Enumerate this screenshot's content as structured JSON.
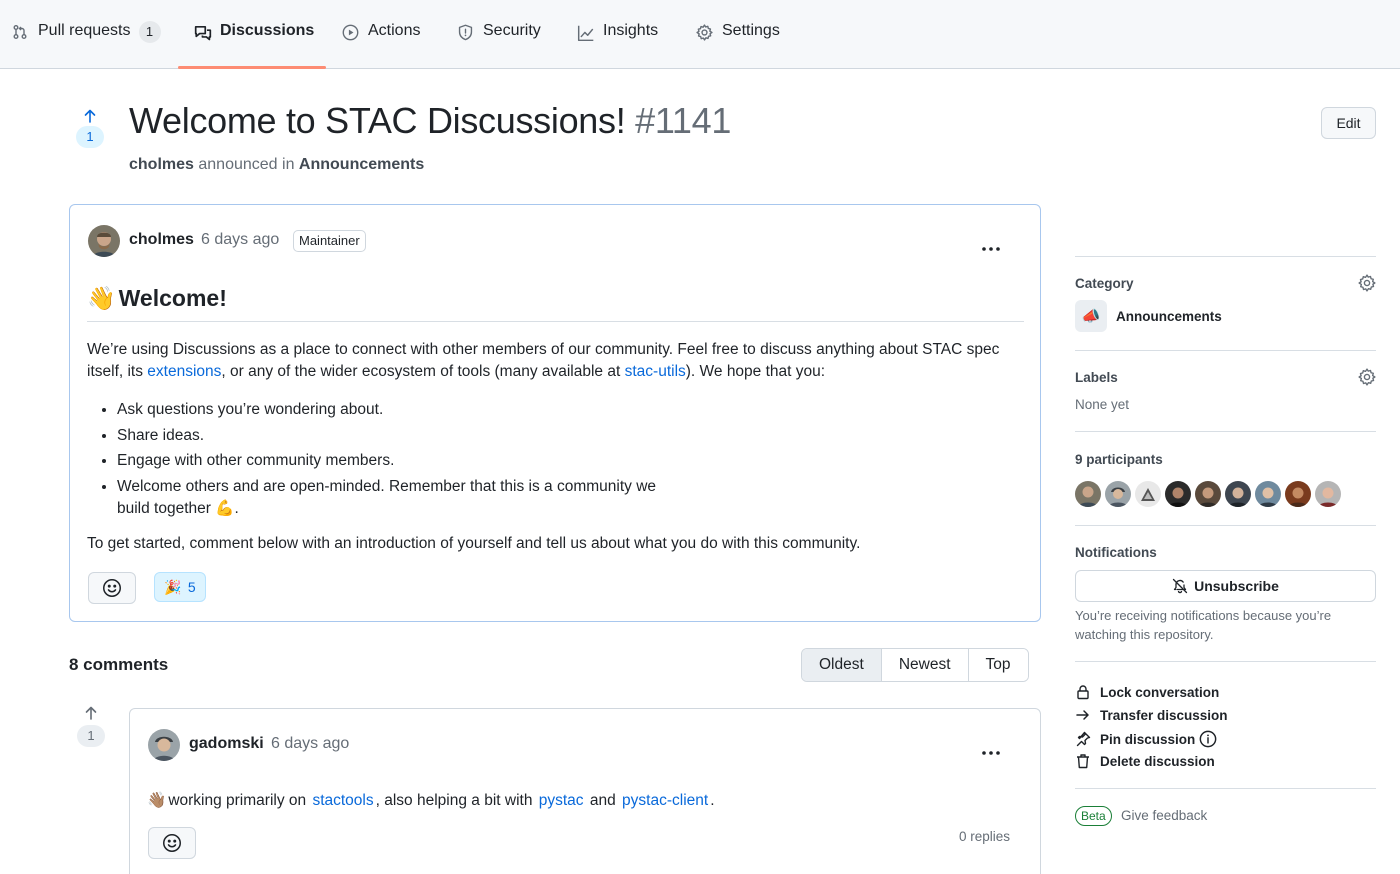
{
  "colors": {
    "accent": "#0969da",
    "nav_underline": "#fd8c73",
    "muted": "#656d76",
    "border": "#d0d7de",
    "post_border": "#a8c7ee",
    "beta_green": "#1a7f37"
  },
  "nav": {
    "pull_requests": {
      "label": "Pull requests",
      "count": "1",
      "icon": "git-pull-request-icon"
    },
    "discussions": {
      "label": "Discussions",
      "icon": "comment-discussion-icon",
      "active": true
    },
    "actions": {
      "label": "Actions",
      "icon": "play-icon"
    },
    "security": {
      "label": "Security",
      "icon": "shield-icon"
    },
    "insights": {
      "label": "Insights",
      "icon": "graph-icon"
    },
    "settings": {
      "label": "Settings",
      "icon": "gear-icon"
    }
  },
  "discussion": {
    "vote_count": "1",
    "title": "Welcome to STAC Discussions!",
    "number": "#1141",
    "author": "cholmes",
    "action_text": "announced in",
    "category": "Announcements",
    "edit_label": "Edit"
  },
  "post": {
    "author": "cholmes",
    "time": "6 days ago",
    "badge": "Maintainer",
    "heading_emoji": "👋",
    "heading": "Welcome!",
    "intro_1": "We’re using Discussions as a place to connect with other members of our community. Feel free to discuss anything about STAC spec itself, its ",
    "link_extensions": "extensions",
    "intro_2": ", or any of the wider ecosystem of tools (many available at ",
    "link_stac_utils": "stac-utils",
    "intro_3": "). We hope that you:",
    "bullets": [
      "Ask questions you’re wondering about.",
      "Share ideas.",
      "Engage with other community members.",
      "Welcome others and are open-minded. Remember that this is a community we build together 💪."
    ],
    "get_started": "To get started, comment below with an introduction of yourself and tell us about what you do with this community.",
    "reaction_emoji": "🎉",
    "reaction_count": "5"
  },
  "comments": {
    "count_label": "8 comments",
    "sort": {
      "oldest": "Oldest",
      "newest": "Newest",
      "top": "Top",
      "selected": "Oldest"
    },
    "items": [
      {
        "vote_count": "1",
        "author": "gadomski",
        "time": "6 days ago",
        "emoji": "👋🏽",
        "text_1": "working primarily on ",
        "link_1": "stactools",
        "text_2": ", also helping a bit with ",
        "link_2": "pystac",
        "text_3": " and ",
        "link_3": "pystac-client",
        "text_4": ".",
        "replies": "0 replies"
      }
    ]
  },
  "sidebar": {
    "category_heading": "Category",
    "category_emoji": "📣",
    "category_name": "Announcements",
    "labels_heading": "Labels",
    "labels_value": "None yet",
    "participants_heading": "9 participants",
    "participants_count": 9,
    "notifications_heading": "Notifications",
    "unsubscribe_label": "Unsubscribe",
    "notifications_note": "You’re receiving notifications because you’re watching this repository.",
    "actions": {
      "lock": "Lock conversation",
      "transfer": "Transfer discussion",
      "pin": "Pin discussion",
      "delete": "Delete discussion"
    },
    "beta_label": "Beta",
    "feedback_label": "Give feedback"
  }
}
